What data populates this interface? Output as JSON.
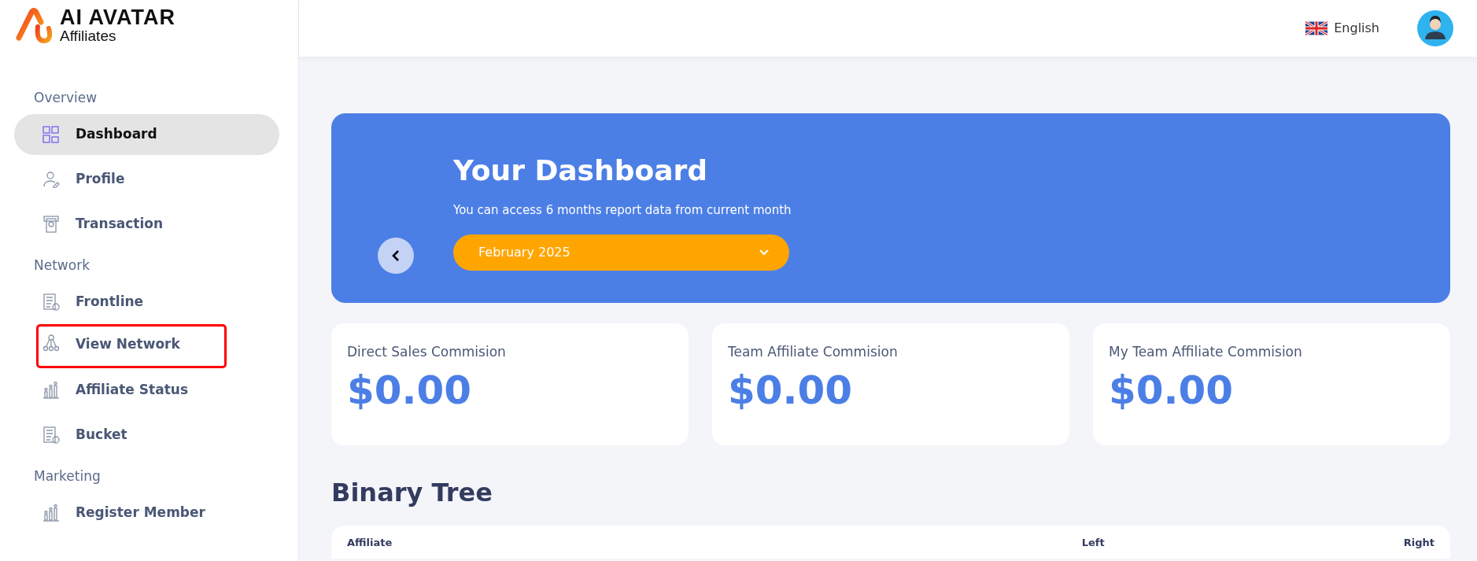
{
  "logo": {
    "title": "AI AVATAR",
    "subtitle": "Affiliates"
  },
  "header": {
    "language": "English"
  },
  "sidebar": {
    "sections": [
      {
        "label": "Overview",
        "items": [
          {
            "label": "Dashboard",
            "selected": true,
            "highlighted": false
          },
          {
            "label": "Profile",
            "selected": false,
            "highlighted": false
          },
          {
            "label": "Transaction",
            "selected": false,
            "highlighted": false
          }
        ]
      },
      {
        "label": "Network",
        "items": [
          {
            "label": "Frontline",
            "selected": false,
            "highlighted": false
          },
          {
            "label": "View Network",
            "selected": false,
            "highlighted": true
          },
          {
            "label": "Affiliate Status",
            "selected": false,
            "highlighted": false
          },
          {
            "label": "Bucket",
            "selected": false,
            "highlighted": false
          }
        ]
      },
      {
        "label": "Marketing",
        "items": [
          {
            "label": "Register Member",
            "selected": false,
            "highlighted": false
          }
        ]
      }
    ]
  },
  "banner": {
    "title": "Your Dashboard",
    "subtitle": "You can access 6 months report data from current month",
    "month": "February 2025"
  },
  "stats": [
    {
      "title": "Direct Sales Commision",
      "value": "$0.00"
    },
    {
      "title": "Team Affiliate Commision",
      "value": "$0.00"
    },
    {
      "title": "My Team Affiliate Commision",
      "value": "$0.00"
    }
  ],
  "binary_tree": {
    "title": "Binary Tree",
    "columns": [
      "Affiliate",
      "Left",
      "Right"
    ]
  }
}
